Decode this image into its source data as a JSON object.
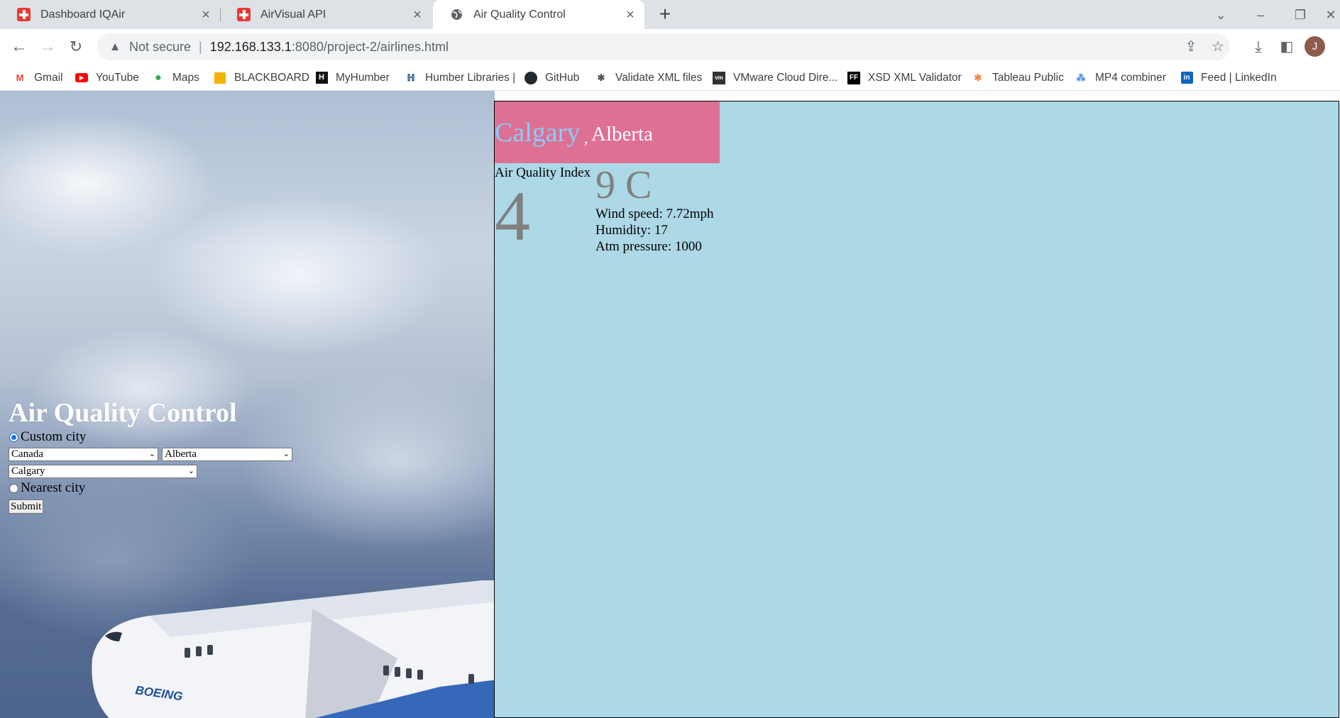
{
  "tabs": [
    {
      "title": "Dashboard IQAir",
      "icon": "swiss-flag-icon"
    },
    {
      "title": "AirVisual API",
      "icon": "swiss-flag-icon"
    },
    {
      "title": "Air Quality Control",
      "icon": "globe-icon",
      "active": true
    }
  ],
  "address": {
    "security_label": "Not secure",
    "host": "192.168.133.1",
    "path": ":8080/project-2/airlines.html"
  },
  "profile_initial": "J",
  "bookmarks": [
    {
      "label": "Gmail",
      "icon": "gmail-icon"
    },
    {
      "label": "YouTube",
      "icon": "youtube-icon"
    },
    {
      "label": "Maps",
      "icon": "maps-icon"
    },
    {
      "label": "BLACKBOARD",
      "icon": "blackboard-icon"
    },
    {
      "label": "MyHumber",
      "icon": "myhumber-icon"
    },
    {
      "label": "Humber Libraries |",
      "icon": "humber-libraries-icon"
    },
    {
      "label": "GitHub",
      "icon": "github-icon"
    },
    {
      "label": "Validate XML files",
      "icon": "xml-validate-icon"
    },
    {
      "label": "VMware Cloud Dire...",
      "icon": "vmware-icon"
    },
    {
      "label": "XSD XML Validator",
      "icon": "ff-icon"
    },
    {
      "label": "Tableau Public",
      "icon": "tableau-icon"
    },
    {
      "label": "MP4 combiner",
      "icon": "mp4-combiner-icon"
    },
    {
      "label": "Feed | LinkedIn",
      "icon": "linkedin-icon"
    }
  ],
  "form": {
    "title": "Air Quality Control",
    "custom_city_label": "Custom city",
    "custom_city_checked": true,
    "country": "Canada",
    "state": "Alberta",
    "city": "Calgary",
    "nearest_city_label": "Nearest city",
    "nearest_city_checked": false,
    "submit_label": "Submit"
  },
  "result": {
    "city": "Calgary",
    "separator": ",",
    "state": "Alberta",
    "aqi_label": "Air Quality Index",
    "aqi_value": "4",
    "temperature": "9 C",
    "wind_speed": "Wind speed: 7.72mph",
    "humidity": "Humidity: 17",
    "pressure": "Atm pressure: 1000"
  },
  "colors": {
    "panel_bg": "#add8e6",
    "header_bg": "#de7094",
    "city_color": "#87cefa",
    "value_gray": "#808080"
  }
}
